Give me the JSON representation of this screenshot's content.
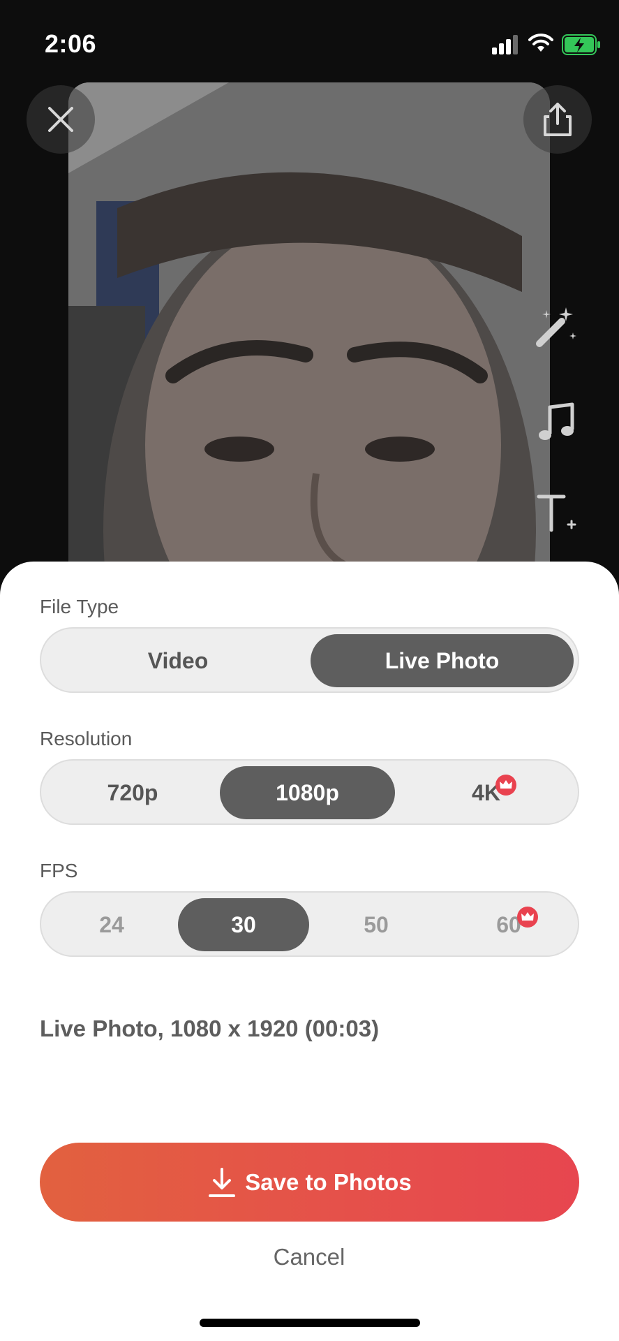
{
  "status_bar": {
    "time": "2:06",
    "signal_icon": "cellular-signal-icon",
    "wifi_icon": "wifi-icon",
    "battery_icon": "battery-charging-icon",
    "battery_color": "#34c759"
  },
  "preview": {
    "close_icon": "close-icon",
    "share_icon": "share-icon",
    "tools": [
      "magic-wand-icon",
      "music-note-icon",
      "add-text-icon"
    ]
  },
  "sheet": {
    "file_type": {
      "label": "File Type",
      "options": [
        "Video",
        "Live Photo"
      ],
      "selected": "Live Photo"
    },
    "resolution": {
      "label": "Resolution",
      "options": [
        "720p",
        "1080p",
        "4K"
      ],
      "selected": "1080p",
      "premium": [
        "4K"
      ]
    },
    "fps": {
      "label": "FPS",
      "options": [
        "24",
        "30",
        "50",
        "60"
      ],
      "selected": "30",
      "premium": [
        "60"
      ]
    },
    "summary": "Live Photo, 1080 x 1920 (00:03)",
    "save_button": "Save to Photos",
    "cancel_button": "Cancel"
  },
  "colors": {
    "accent_start": "#e2613f",
    "accent_end": "#e7464f",
    "premium_badge": "#e9424f",
    "selected_segment": "#5e5e5e"
  }
}
